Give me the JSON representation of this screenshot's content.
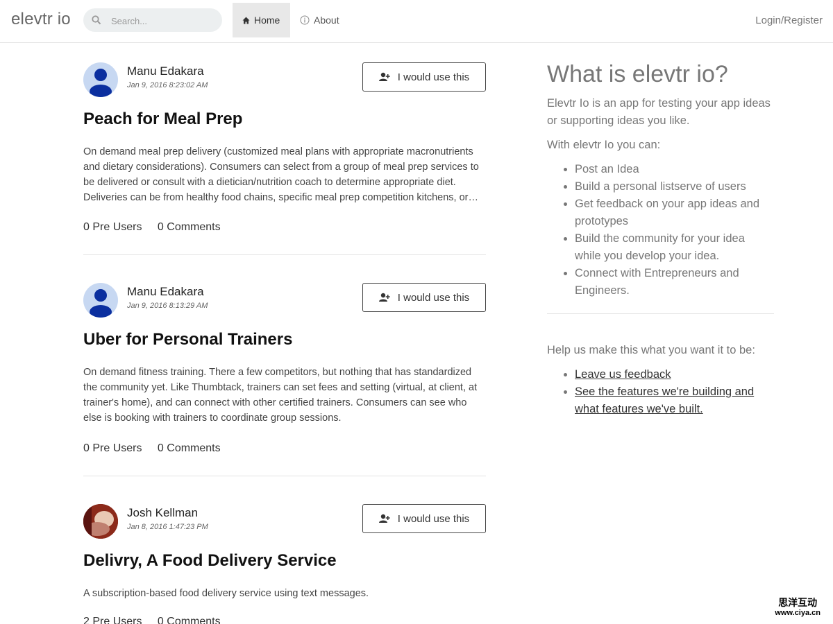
{
  "nav": {
    "brand": "elevtr io",
    "search_placeholder": "Search...",
    "tabs": [
      {
        "label": "Home",
        "icon": "home-icon",
        "active": true
      },
      {
        "label": "About",
        "icon": "info-icon",
        "active": false
      }
    ],
    "login": "Login/Register"
  },
  "posts": [
    {
      "author": "Manu Edakara",
      "timestamp": "Jan 9, 2016 8:23:02 AM",
      "button": "I would use this",
      "title": "Peach for Meal Prep",
      "description": "On demand meal prep delivery (customized meal plans with appropriate macronutrients and dietary considerations). Consumers can select from a group of meal prep services to be delivered or consult with a dietician/nutrition coach to determine appropriate diet. Deliveries can be from healthy food chains, specific meal prep competition kitchens, or…",
      "pre_users": "0 Pre Users",
      "comments": "0 Comments"
    },
    {
      "author": "Manu Edakara",
      "timestamp": "Jan 9, 2016 8:13:29 AM",
      "button": "I would use this",
      "title": "Uber for Personal Trainers",
      "description": "On demand fitness training. There a few competitors, but nothing that has standardized the community yet. Like Thumbtack, trainers can set fees and setting (virtual, at client, at trainer's home), and can connect with other certified trainers. Consumers can see who else is booking with trainers to coordinate group sessions.",
      "pre_users": "0 Pre Users",
      "comments": "0 Comments"
    },
    {
      "author": "Josh Kellman",
      "timestamp": "Jan 8, 2016 1:47:23 PM",
      "button": "I would use this",
      "title": "Delivry, A Food Delivery Service",
      "description": "A subscription-based food delivery service using text messages.",
      "pre_users": "2 Pre Users",
      "comments": "0 Comments"
    }
  ],
  "sidebar": {
    "heading": "What is elevtr io?",
    "intro": "Elevtr Io is an app for testing your app ideas or supporting ideas you like.",
    "with_text": "With elevtr Io you can:",
    "features": [
      "Post an Idea",
      "Build a personal listserve of users",
      "Get feedback on your app ideas and prototypes",
      "Build the community for your idea while you develop your idea.",
      "Connect with Entrepreneurs and Engineers."
    ],
    "help_text": "Help us make this what you want it to be:",
    "links": [
      "Leave us feedback",
      "See the features we're building and what features we've built."
    ]
  },
  "watermark": {
    "line1": "思洋互动",
    "line2": "www.ciya.cn"
  },
  "colors": {
    "active_tab_bg": "#e8e8e8",
    "avatar_bg": "#c7d8f2",
    "avatar_figure": "#0b2f9f"
  }
}
